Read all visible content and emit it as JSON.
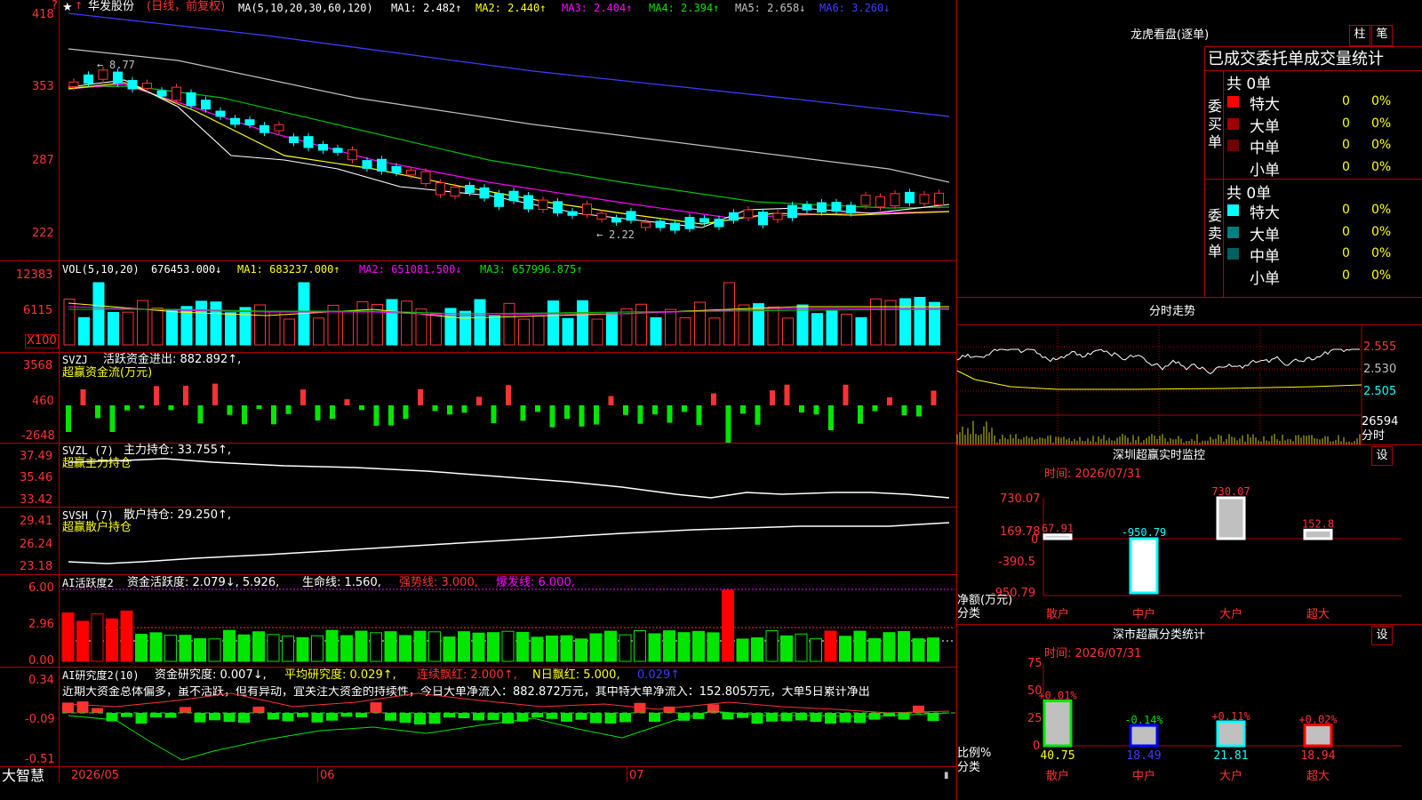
{
  "header": {
    "corner_mark": "?",
    "star": "★",
    "stock_name": "华发股份",
    "period_label": "(日线，前复权)",
    "ma_params": "MA(5,10,20,30,60,120)",
    "ma1": "MA1: 2.482↑",
    "ma2": "MA2: 2.440↑",
    "ma3": "MA3: 2.404↑",
    "ma4": "MA4: 2.394↑",
    "ma5": "MA5: 2.658↓",
    "ma6": "MA6: 3.260↓"
  },
  "price_axis": [
    "418",
    "353",
    "287",
    "222"
  ],
  "price_annotations": {
    "high": "8.77",
    "low": "2.22"
  },
  "vol_panel": {
    "params": "VOL(5,10,20)",
    "value": "676453.000↓",
    "ma1": "MA1: 683237.000↑",
    "ma2": "MA2: 651081.500↓",
    "ma3": "MA3: 657996.875↑",
    "axis": [
      "12383",
      "6115",
      "X100"
    ]
  },
  "svzj_panel": {
    "name": "SVZJ",
    "line1": "活跃资金进出: 882.892↑,",
    "line2": "超赢资金流(万元)",
    "axis": [
      "3568",
      "460",
      "-2648"
    ]
  },
  "svzl_panel": {
    "name": "SVZL (7)",
    "line1": "主力持仓: 33.755↑,",
    "line2": "超赢主力持仓",
    "axis": [
      "37.49",
      "35.46",
      "33.42"
    ]
  },
  "svsh_panel": {
    "name": "SVSH (7)",
    "line1": "散户持仓: 29.250↑,",
    "line2": "超赢散户持仓",
    "axis": [
      "29.41",
      "26.24",
      "23.18"
    ]
  },
  "ai_active_panel": {
    "name": "AI活跃度2",
    "line1": "资金活跃度: 2.079↓, 5.926,",
    "life": "生命线: 1.560,",
    "strong": "强势线: 3.000,",
    "burst": "爆发线: 6.000,",
    "axis": [
      "6.00",
      "2.96",
      "0.00"
    ]
  },
  "ai_research_panel": {
    "name": "AI研究度2(10)",
    "research": "资金研究度: 0.007↓,",
    "avg": "平均研究度: 0.029↑,",
    "cont": "连续飘红: 2.000↑,",
    "nday": "N日飘红: 5.000,",
    "val": "0.029↑",
    "comment": "近期大资金总体偏多，虽不活跃，但有异动，宜关注大资金的持续性，今日大单净流入：882.872万元，其中特大单净流入：152.805万元，大单5日累计净出",
    "axis": [
      "0.34",
      "-0.09",
      "-0.51"
    ]
  },
  "bottom_bar": {
    "brand": "大智慧",
    "dates": [
      "2026/05",
      "06",
      "07"
    ]
  },
  "right_panel": {
    "dragon_title": "龙虎看盘(逐单)",
    "btn_zhu": "柱",
    "btn_bi": "笔",
    "stat_title": "已成交委托单成交量统计",
    "buy_side_label": "委买单",
    "sell_side_label": "委卖单",
    "buy_total": "共 0单",
    "sell_total": "共 0单",
    "buy_rows": [
      {
        "label": "特大",
        "count": "0",
        "pct": "0%",
        "color": "#ff0000"
      },
      {
        "label": "大单",
        "count": "0",
        "pct": "0%",
        "color": "#a00000"
      },
      {
        "label": "中单",
        "count": "0",
        "pct": "0%",
        "color": "#700000"
      },
      {
        "label": "小单",
        "count": "0",
        "pct": "0%",
        "color": ""
      }
    ],
    "sell_rows": [
      {
        "label": "特大",
        "count": "0",
        "pct": "0%",
        "color": "#00ffff"
      },
      {
        "label": "大单",
        "count": "0",
        "pct": "0%",
        "color": "#008080"
      },
      {
        "label": "中单",
        "count": "0",
        "pct": "0%",
        "color": "#006060"
      },
      {
        "label": "小单",
        "count": "0",
        "pct": "0%",
        "color": ""
      }
    ],
    "intraday_title": "分时走势",
    "intraday_axis": [
      "2.555",
      "2.530",
      "2.505"
    ],
    "intraday_vol": "26594",
    "intraday_label": "分时",
    "monitor_title": "深圳超赢实时监控",
    "monitor_btn": "设",
    "monitor_time": "时间: 2026/07/31",
    "monitor_axis": [
      "730.07",
      "169.78",
      "0",
      "-390.5",
      "-950.79"
    ],
    "monitor_ylabel1": "净额(万元)",
    "monitor_ylabel2": "分类",
    "class_title": "深市超赢分类统计",
    "class_btn": "设",
    "class_time": "时间: 2026/07/31",
    "class_axis": [
      "75",
      "50",
      "25",
      "0"
    ],
    "class_ylabel1": "比例%",
    "class_ylabel2": "分类"
  },
  "chart_data": [
    {
      "type": "bar",
      "title": "深圳超赢实时监控",
      "ylabel": "净额(万元)",
      "categories": [
        "散户",
        "中户",
        "大户",
        "超大"
      ],
      "values": [
        67.91,
        -950.79,
        730.07,
        152.8
      ],
      "labels": [
        "67.91",
        "-950.79",
        "730.07",
        "152.8"
      ],
      "ylim": [
        -950.79,
        730.07
      ]
    },
    {
      "type": "bar",
      "title": "深市超赢分类统计",
      "ylabel": "比例%",
      "categories": [
        "散户",
        "中户",
        "大户",
        "超大"
      ],
      "values": [
        40.75,
        18.49,
        21.81,
        18.94
      ],
      "changes": [
        "+0.01%",
        "-0.14%",
        "+0.11%",
        "+0.02%"
      ],
      "ylim": [
        0,
        75
      ]
    }
  ]
}
